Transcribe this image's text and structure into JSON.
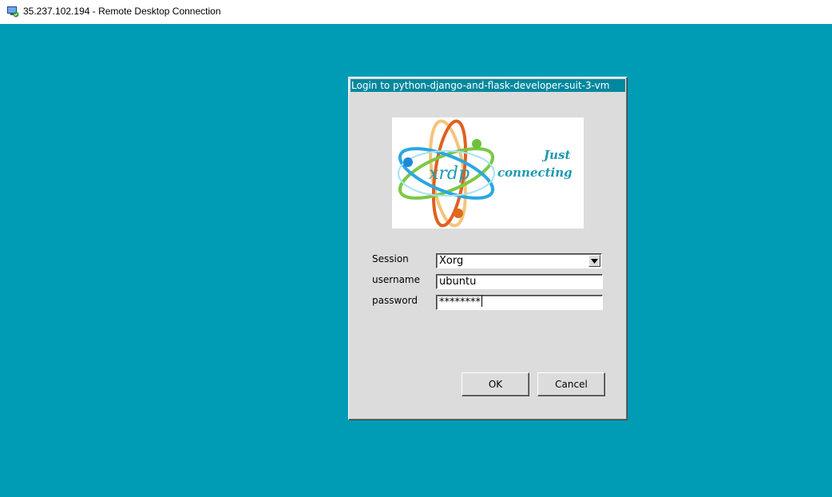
{
  "window": {
    "title": "35.237.102.194 - Remote Desktop Connection",
    "icon": "remote-desktop-icon"
  },
  "dialog": {
    "title": "Login to python-django-and-flask-developer-suit-3-vm",
    "logo": {
      "word": "xrdp",
      "tagline_line1": "Just",
      "tagline_line2": "connecting"
    },
    "fields": {
      "session_label": "Session",
      "session_value": "Xorg",
      "username_label": "username",
      "username_value": "ubuntu",
      "password_label": "password",
      "password_value": "********"
    },
    "buttons": {
      "ok_label": "OK",
      "cancel_label": "Cancel"
    }
  },
  "colors": {
    "desktop_background": "#009cb5",
    "dialog_background": "#dcdcdc",
    "dialog_title_background": "#00889e"
  }
}
